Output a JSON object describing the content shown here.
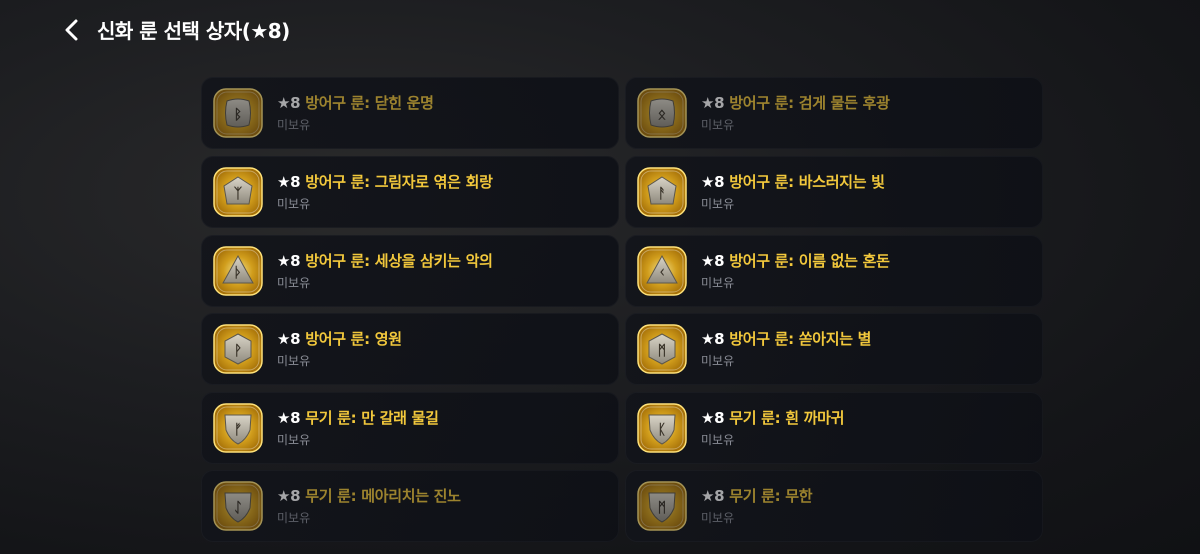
{
  "header": {
    "title": "신화 룬 선택 상자(★8)"
  },
  "colors": {
    "accent_gold": "#f2c83c",
    "star_white": "#ffffff",
    "sub_text": "#8a8d96"
  },
  "runes": [
    {
      "star": "★8",
      "name": "방어구 룬: 닫힌 운명",
      "status": "미보유",
      "icon": "rune-stone-b-icon",
      "glyph": "ᛒ",
      "shape": "square",
      "dim": true
    },
    {
      "star": "★8",
      "name": "방어구 룬: 검게 물든 후광",
      "status": "미보유",
      "icon": "rune-stone-o-icon",
      "glyph": "ᛟ",
      "shape": "square",
      "dim": true
    },
    {
      "star": "★8",
      "name": "방어구 룬: 그림자로 엮은 회랑",
      "status": "미보유",
      "icon": "rune-stone-y-icon",
      "glyph": "ᛉ",
      "shape": "pentagon",
      "dim": false
    },
    {
      "star": "★8",
      "name": "방어구 룬: 바스러지는 빛",
      "status": "미보유",
      "icon": "rune-stone-a-icon",
      "glyph": "ᚨ",
      "shape": "pentagon",
      "dim": false
    },
    {
      "star": "★8",
      "name": "방어구 룬: 세상을 삼키는 악의",
      "status": "미보유",
      "icon": "rune-stone-d-icon",
      "glyph": "ᚦ",
      "shape": "triangle",
      "dim": false
    },
    {
      "star": "★8",
      "name": "방어구 룬: 이름 없는 혼돈",
      "status": "미보유",
      "icon": "rune-stone-k-icon",
      "glyph": "ᚲ",
      "shape": "triangle",
      "dim": false
    },
    {
      "star": "★8",
      "name": "방어구 룬: 영원",
      "status": "미보유",
      "icon": "rune-stone-p-icon",
      "glyph": "ᚹ",
      "shape": "hexagon",
      "dim": false
    },
    {
      "star": "★8",
      "name": "방어구 룬: 쏟아지는 별",
      "status": "미보유",
      "icon": "rune-stone-m-icon",
      "glyph": "ᛗ",
      "shape": "hexagon",
      "dim": false
    },
    {
      "star": "★8",
      "name": "무기 룬: 만 갈래 물길",
      "status": "미보유",
      "icon": "rune-stone-f-icon",
      "glyph": "ᚠ",
      "shape": "shield",
      "dim": false
    },
    {
      "star": "★8",
      "name": "무기 룬: 흰 까마귀",
      "status": "미보유",
      "icon": "rune-stone-n-icon",
      "glyph": "ᛕ",
      "shape": "shield",
      "dim": false
    },
    {
      "star": "★8",
      "name": "무기 룬: 메아리치는 진노",
      "status": "미보유",
      "icon": "rune-stone-i-icon",
      "glyph": "ᛇ",
      "shape": "shield",
      "dim": true
    },
    {
      "star": "★8",
      "name": "무기 룬: 무한",
      "status": "미보유",
      "icon": "rune-stone-m2-icon",
      "glyph": "ᛗ",
      "shape": "shield",
      "dim": true
    }
  ]
}
